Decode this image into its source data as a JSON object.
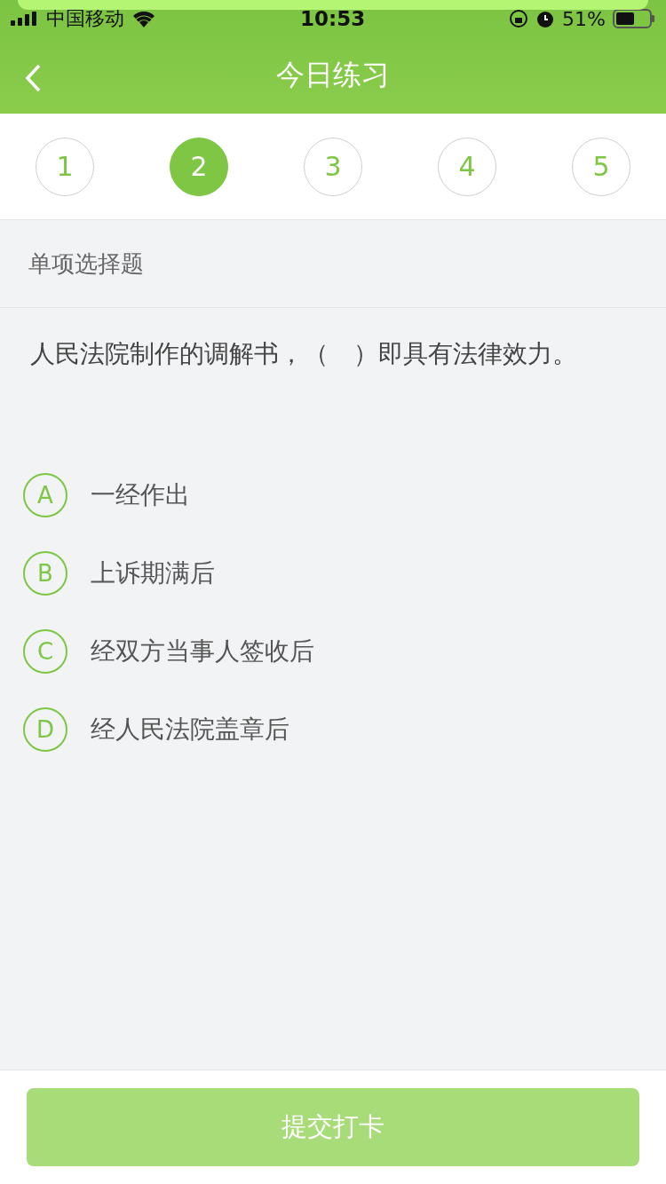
{
  "status_bar": {
    "carrier": "中国移动",
    "time": "10:53",
    "battery": "51%"
  },
  "nav": {
    "title": "今日练习"
  },
  "steps": [
    {
      "label": "1",
      "selected": false
    },
    {
      "label": "2",
      "selected": true
    },
    {
      "label": "3",
      "selected": false
    },
    {
      "label": "4",
      "selected": false
    },
    {
      "label": "5",
      "selected": false
    }
  ],
  "question_type": "单项选择题",
  "question": "人民法院制作的调解书，（　）即具有法律效力。",
  "options": [
    {
      "letter": "A",
      "text": "一经作出",
      "selected": false
    },
    {
      "letter": "B",
      "text": "上诉期满后",
      "selected": false
    },
    {
      "letter": "C",
      "text": "经双方当事人签收后",
      "selected": false
    },
    {
      "letter": "D",
      "text": "经人民法院盖章后",
      "selected": false
    }
  ],
  "submit_button": {
    "label": "提交打卡",
    "disabled": true
  }
}
